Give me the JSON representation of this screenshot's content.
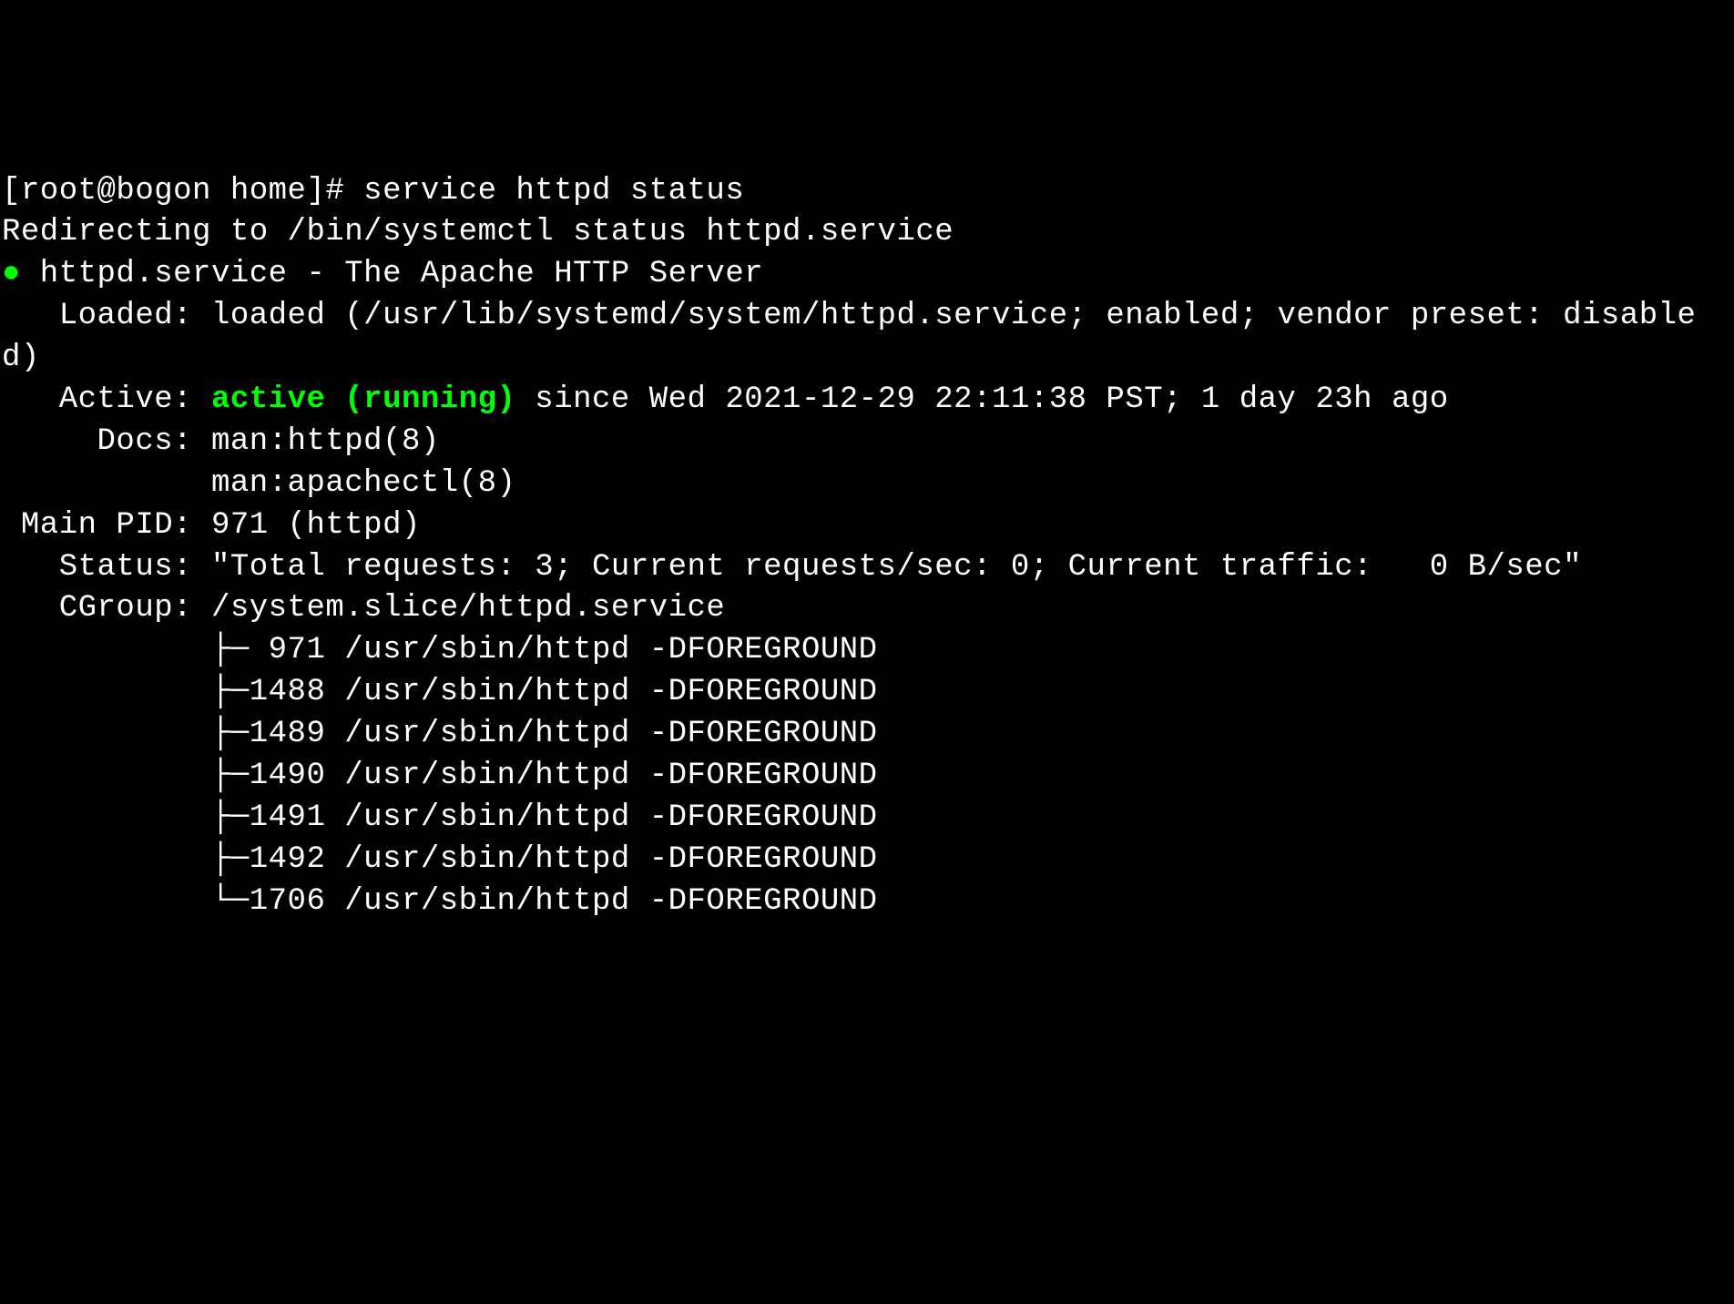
{
  "prompt": "[root@bogon home]# ",
  "command": "service httpd status",
  "redirect": "Redirecting to /bin/systemctl status httpd.service",
  "dot": "●",
  "service_line": " httpd.service - The Apache HTTP Server",
  "loaded_prefix": "   Loaded: loaded (/usr/lib/systemd/system/httpd.service; enabled; vendor preset: disabled)",
  "active_prefix": "   Active: ",
  "active_state": "active (running)",
  "active_since": " since Wed 2021-12-29 22:11:38 PST; 1 day 23h ago",
  "docs1": "     Docs: man:httpd(8)",
  "docs2": "           man:apachectl(8)",
  "main_pid": " Main PID: 971 (httpd)",
  "status": "   Status: \"Total requests: 3; Current requests/sec: 0; Current traffic:   0 B/sec\"",
  "cgroup": "   CGroup: /system.slice/httpd.service",
  "proc1": "           ├─ 971 /usr/sbin/httpd -DFOREGROUND",
  "proc2": "           ├─1488 /usr/sbin/httpd -DFOREGROUND",
  "proc3": "           ├─1489 /usr/sbin/httpd -DFOREGROUND",
  "proc4": "           ├─1490 /usr/sbin/httpd -DFOREGROUND",
  "proc5": "           ├─1491 /usr/sbin/httpd -DFOREGROUND",
  "proc6": "           ├─1492 /usr/sbin/httpd -DFOREGROUND",
  "proc7": "           └─1706 /usr/sbin/httpd -DFOREGROUND"
}
